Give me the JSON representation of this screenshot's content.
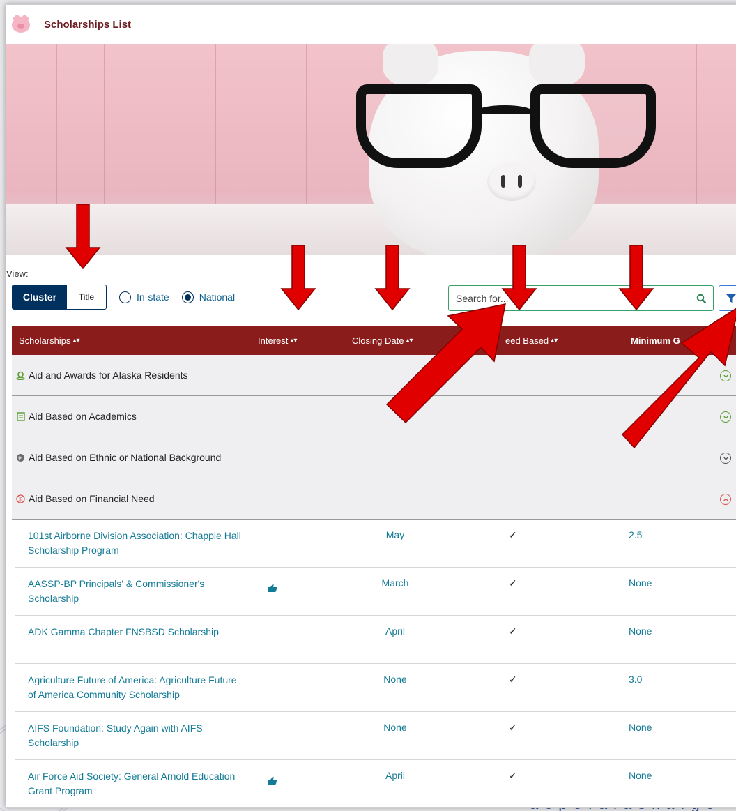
{
  "window": {
    "title": "Scholarships List"
  },
  "view": {
    "label": "View:",
    "toggle_cluster": "Cluster",
    "toggle_title": "Title",
    "radio_instate": "In-state",
    "radio_national": "National",
    "selected_radio": "National"
  },
  "search": {
    "placeholder": "Search for..."
  },
  "table": {
    "headers": {
      "scholarships": "Scholarships",
      "interest": "Interest",
      "closing": "Closing Date",
      "need": "eed Based",
      "gpa": "Minimum G"
    },
    "categories": [
      {
        "label": "Aid and Awards for Alaska Residents",
        "icon": "location-pin-icon",
        "expanded": false
      },
      {
        "label": "Aid Based on Academics",
        "icon": "academics-icon",
        "expanded": false
      },
      {
        "label": "Aid Based on Ethnic or National Background",
        "icon": "globe-icon",
        "expanded": false
      },
      {
        "label": "Aid Based on Financial Need",
        "icon": "dollar-icon",
        "expanded": true
      }
    ],
    "rows": [
      {
        "name": "101st Airborne Division Association: Chappie Hall Scholarship Program",
        "interest": false,
        "closing": "May",
        "need": "✓",
        "gpa": "2.5"
      },
      {
        "name": "AASSP-BP Principals' & Commissioner's Scholarship",
        "interest": true,
        "closing": "March",
        "need": "✓",
        "gpa": "None"
      },
      {
        "name": "ADK Gamma Chapter FNSBSD Scholarship",
        "interest": false,
        "closing": "April",
        "need": "✓",
        "gpa": "None"
      },
      {
        "name": "Agriculture Future of America: Agriculture Future of America Community Scholarship",
        "interest": false,
        "closing": "None",
        "need": "✓",
        "gpa": "3.0"
      },
      {
        "name": "AIFS Foundation: Study Again with AIFS Scholarship",
        "interest": false,
        "closing": "None",
        "need": "✓",
        "gpa": "None"
      },
      {
        "name": "Air Force Aid Society: General Arnold Education Grant Program",
        "interest": true,
        "closing": "April",
        "need": "✓",
        "gpa": "None"
      }
    ]
  },
  "footer": {
    "url": "acpe.alaska.go"
  },
  "colors": {
    "header_bg": "#8b1c1c",
    "primary": "#00305e",
    "link": "#137b96",
    "annotation_arrow": "#e00000"
  }
}
